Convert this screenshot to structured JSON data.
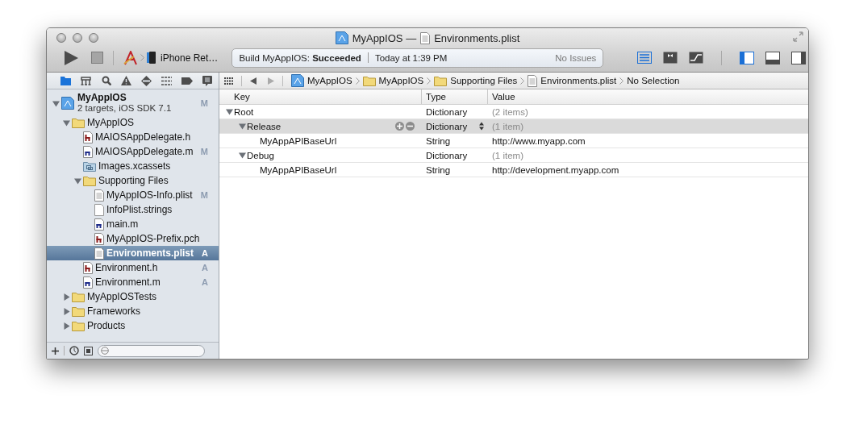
{
  "window": {
    "project": "MyAppIOS",
    "separator": "—",
    "file": "Environments.plist"
  },
  "toolbar": {
    "scheme": "iPhone Ret…",
    "build": "Build MyAppIOS: **Succeeded**",
    "time": "Today at 1:39 PM",
    "issues": "No Issues",
    "editor_buttons": [
      {
        "kind": "standard",
        "selected": true
      },
      {
        "kind": "assistant",
        "selected": false
      },
      {
        "kind": "version",
        "selected": false
      }
    ],
    "view_buttons": [
      {
        "kind": "navigator",
        "selected": true
      },
      {
        "kind": "debug",
        "selected": false
      },
      {
        "kind": "utilities",
        "selected": false
      }
    ]
  },
  "navigator_tabs": [
    {
      "kind": "project",
      "selected": true
    },
    {
      "kind": "symbol",
      "selected": false
    },
    {
      "kind": "search",
      "selected": false
    },
    {
      "kind": "issue",
      "selected": false
    },
    {
      "kind": "test",
      "selected": false
    },
    {
      "kind": "debug",
      "selected": false
    },
    {
      "kind": "breakpoint",
      "selected": false
    },
    {
      "kind": "log",
      "selected": false
    }
  ],
  "project": {
    "name": "MyAppIOS",
    "subtitle": "2 targets, iOS SDK 7.1",
    "badge": "M",
    "expanded": true
  },
  "tree": [
    {
      "name": "MyAppIOS",
      "kind": "folder",
      "expanded": true,
      "selected": false,
      "children": [
        {
          "name": "MAIOSAppDelegate.h",
          "kind": "h",
          "selected": false
        },
        {
          "name": "MAIOSAppDelegate.m",
          "kind": "m",
          "badge": "M",
          "selected": false
        },
        {
          "name": "Images.xcassets",
          "kind": "assets",
          "selected": false
        },
        {
          "name": "Supporting Files",
          "kind": "folder",
          "expanded": true,
          "selected": false,
          "children": [
            {
              "name": "MyAppIOS-Info.plist",
              "kind": "plist",
              "badge": "M",
              "selected": false
            },
            {
              "name": "InfoPlist.strings",
              "kind": "strings",
              "selected": false
            },
            {
              "name": "main.m",
              "kind": "m",
              "selected": false
            },
            {
              "name": "MyAppIOS-Prefix.pch",
              "kind": "h",
              "selected": false
            },
            {
              "name": "Environments.plist",
              "kind": "plist",
              "badge": "A",
              "selected": true
            }
          ]
        },
        {
          "name": "Environment.h",
          "kind": "h",
          "badge": "A",
          "selected": false
        },
        {
          "name": "Environment.m",
          "kind": "m",
          "badge": "A",
          "selected": false
        }
      ]
    },
    {
      "name": "MyAppIOSTests",
      "kind": "folder",
      "expanded": false,
      "selected": false
    },
    {
      "name": "Frameworks",
      "kind": "folder",
      "expanded": false,
      "selected": false
    },
    {
      "name": "Products",
      "kind": "folder",
      "expanded": false,
      "selected": false
    }
  ],
  "jump_bar": [
    {
      "kind": "project",
      "label": "MyAppIOS"
    },
    {
      "kind": "folder",
      "label": "MyAppIOS"
    },
    {
      "kind": "folder",
      "label": "Supporting Files"
    },
    {
      "kind": "plist",
      "label": "Environments.plist"
    },
    {
      "kind": "none",
      "label": "No Selection"
    }
  ],
  "plist": {
    "columns": [
      "Key",
      "Type",
      "Value"
    ],
    "rows": [
      {
        "key": "Root",
        "type": "Dictionary",
        "value": "(2 items)",
        "kind": "dictionary",
        "expanded": true,
        "selected": false,
        "children": [
          {
            "key": "Release",
            "type": "Dictionary",
            "value": "(1 item)",
            "kind": "dictionary",
            "expanded": true,
            "selected": true,
            "children": [
              {
                "key": "MyAppAPIBaseUrl",
                "type": "String",
                "value": "http://www.myapp.com",
                "kind": "string",
                "selected": false
              }
            ]
          },
          {
            "key": "Debug",
            "type": "Dictionary",
            "value": "(1 item)",
            "kind": "dictionary",
            "expanded": true,
            "selected": false,
            "children": [
              {
                "key": "MyAppAPIBaseUrl",
                "type": "String",
                "value": "http://development.myapp.com",
                "kind": "string",
                "selected": false
              }
            ]
          }
        ]
      }
    ]
  }
}
